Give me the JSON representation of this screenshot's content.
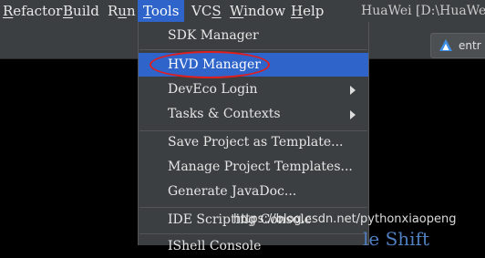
{
  "menubar": {
    "items": [
      {
        "label": "Refactor"
      },
      {
        "label": "Build"
      },
      {
        "label": "Run"
      },
      {
        "label": "Tools"
      },
      {
        "label": "VCS"
      },
      {
        "label": "Window"
      },
      {
        "label": "Help"
      }
    ],
    "active": "Tools"
  },
  "window_title": "HuaWei [D:\\HuaWei",
  "toolbar": {
    "entry_combo": {
      "label": "entr",
      "icon": "huawei-app-icon"
    }
  },
  "tools_menu": {
    "items": [
      {
        "label": "SDK Manager"
      },
      {
        "label": "HVD Manager",
        "selected": true
      },
      {
        "label": "DevEco Login",
        "submenu": true
      },
      {
        "label": "Tasks & Contexts",
        "submenu": true
      },
      {
        "label": "Save Project as Template..."
      },
      {
        "label": "Manage Project Templates..."
      },
      {
        "label": "Generate JavaDoc..."
      },
      {
        "label": "IDE Scripting Console"
      },
      {
        "label": "IShell Console"
      }
    ]
  },
  "annotation": {
    "color": "#e01e1e",
    "shape": "ellipse",
    "target": "HVD Manager"
  },
  "background_text": "le Shift",
  "watermark": "https://blog.csdn.net/pythonxiaopeng",
  "colors": {
    "menubar_bg": "#3c3f41",
    "selection": "#2f65ca",
    "text": "#e6e6e6",
    "editor_bg": "#000000"
  }
}
